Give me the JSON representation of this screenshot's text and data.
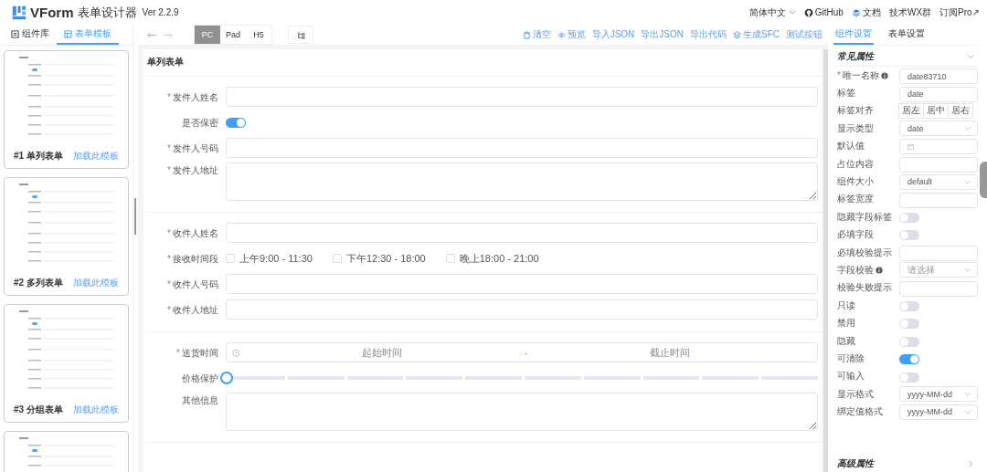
{
  "header": {
    "brand": "VForm",
    "title": "表单设计器",
    "version": "Ver 2.2.9",
    "links": [
      {
        "kind": "language",
        "label": "简体中文"
      },
      {
        "kind": "github",
        "label": "GitHub"
      },
      {
        "kind": "docs",
        "label": "文档"
      },
      {
        "kind": "plain",
        "label": "技术WX群"
      },
      {
        "kind": "plain",
        "label": "订阅Pro↗"
      }
    ]
  },
  "left_tabs": [
    {
      "kind": "widgets",
      "label": "组件库",
      "selected": false
    },
    {
      "kind": "templates",
      "label": "表单模板",
      "selected": true
    }
  ],
  "templates": [
    {
      "kind": "full",
      "title": "#1 单列表单",
      "action": "加载此模板"
    },
    {
      "kind": "full",
      "title": "#2 多列表单",
      "action": "加载此模板"
    },
    {
      "kind": "full",
      "title": "#3 分组表单",
      "action": "加载此模板"
    },
    {
      "kind": "partial"
    }
  ],
  "toolbar": {
    "devices": [
      {
        "label": "PC",
        "selected": true
      },
      {
        "label": "Pad",
        "selected": false
      },
      {
        "label": "H5",
        "selected": false
      }
    ],
    "actions": [
      {
        "kind": "trash",
        "label": "清空"
      },
      {
        "kind": "eye",
        "label": "预览"
      },
      {
        "kind": "plain",
        "label": "导入JSON"
      },
      {
        "kind": "plain",
        "label": "导出JSON"
      },
      {
        "kind": "plain",
        "label": "导出代码"
      },
      {
        "kind": "stack",
        "label": "生成SFC"
      },
      {
        "kind": "plain",
        "label": "测试按钮"
      }
    ]
  },
  "form": {
    "title": "单列表单",
    "sections": [
      {
        "fields": [
          {
            "kind": "input",
            "mark": "*",
            "label": "发件人姓名"
          },
          {
            "kind": "switch",
            "label": "是否保密",
            "on": true
          },
          {
            "kind": "input",
            "mark": "*",
            "label": "发件人号码"
          },
          {
            "kind": "textarea",
            "mark": "*",
            "label": "发件人地址"
          }
        ]
      },
      {
        "fields": [
          {
            "kind": "input",
            "mark": "*",
            "label": "收件人姓名"
          },
          {
            "kind": "checkboxes",
            "mark": "*",
            "label": "接收时间段",
            "options": [
              {
                "label": "上午9:00 - 11:30",
                "checked": false
              },
              {
                "label": "下午12:30 - 18:00",
                "checked": false
              },
              {
                "label": "晚上18:00 - 21:00",
                "checked": false
              }
            ]
          },
          {
            "kind": "input",
            "mark": "*",
            "label": "收件人号码"
          },
          {
            "kind": "input",
            "mark": "*",
            "label": "收件人地址"
          }
        ]
      },
      {
        "fields": [
          {
            "kind": "daterange",
            "mark": "*",
            "label": "送货时间",
            "start_placeholder": "起始时间",
            "separator": "-",
            "end_placeholder": "截止时间"
          },
          {
            "kind": "slider",
            "label": "价格保护",
            "level": 0
          },
          {
            "kind": "textarea",
            "label": "其他信息"
          }
        ]
      }
    ]
  },
  "settings": {
    "tabs": [
      {
        "label": "组件设置",
        "selected": true
      },
      {
        "label": "表单设置",
        "selected": false
      }
    ],
    "section": "常见属性",
    "footer_section": "高级属性",
    "props": [
      {
        "kind": "input",
        "mark": "*",
        "label": "唯一名称",
        "info": true,
        "value": "date83710"
      },
      {
        "kind": "input",
        "label": "标签",
        "value": "date"
      },
      {
        "kind": "radio",
        "label": "标签对齐",
        "options": [
          {
            "label": "居左",
            "selected": false
          },
          {
            "label": "居中",
            "selected": false
          },
          {
            "label": "居右",
            "selected": false
          }
        ]
      },
      {
        "kind": "select",
        "label": "显示类型",
        "value": "date"
      },
      {
        "kind": "date",
        "label": "默认值"
      },
      {
        "kind": "input",
        "label": "占位内容"
      },
      {
        "kind": "select",
        "label": "组件大小",
        "value": "default"
      },
      {
        "kind": "input",
        "label": "标签宽度"
      },
      {
        "kind": "switch",
        "label": "隐藏字段标签",
        "on": false
      },
      {
        "kind": "switch",
        "label": "必填字段",
        "on": false
      },
      {
        "kind": "input",
        "label": "必填校验提示"
      },
      {
        "kind": "select",
        "label": "字段校验",
        "info": true,
        "placeholder": "请选择"
      },
      {
        "kind": "input",
        "label": "校验失败提示"
      },
      {
        "kind": "switch",
        "label": "只读",
        "on": false
      },
      {
        "kind": "switch",
        "label": "禁用",
        "on": false
      },
      {
        "kind": "switch",
        "label": "隐藏",
        "on": false
      },
      {
        "kind": "switch",
        "label": "可清除",
        "on": true
      },
      {
        "kind": "switch",
        "label": "可输入",
        "on": false
      },
      {
        "kind": "select",
        "label": "显示格式",
        "value": "yyyy-MM-dd"
      },
      {
        "kind": "select",
        "label": "绑定值格式",
        "value": "yyyy-MM-dd"
      }
    ]
  }
}
